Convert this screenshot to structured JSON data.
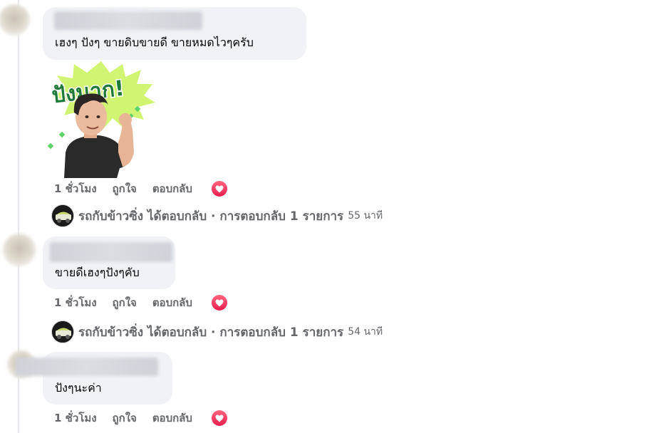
{
  "comments": [
    {
      "text": "เฮงๆ ปังๆ ขายดิบขายดี ขายหมดไวๆครับ",
      "sticker_text": "ปังมาก!",
      "time": "1 ชั่วโมง",
      "like": "ถูกใจ",
      "reply": "ตอบกลับ",
      "reaction": "heart-reaction-icon"
    },
    {
      "text": "ขายดีเฮงๆปังๆคับ",
      "time": "1 ชั่วโมง",
      "like": "ถูกใจ",
      "reply": "ตอบกลับ",
      "reaction": "heart-reaction-icon"
    },
    {
      "text": "ปังๆนะค่า",
      "time": "1 ชั่วโมง",
      "like": "ถูกใจ",
      "reply": "ตอบกลับ",
      "reaction": "heart-reaction-icon"
    }
  ],
  "replies": [
    {
      "text": "รถกับข้าวซิ่ง ได้ตอบกลับ · การตอบกลับ 1 รายการ",
      "time": "55 นาที"
    },
    {
      "text": "รถกับข้าวซิ่ง ได้ตอบกลับ · การตอบกลับ 1 รายการ",
      "time": "54 นาที"
    }
  ],
  "colors": {
    "bubble": "#f0f2f5",
    "meta_text": "#65676b",
    "heart": "#f33e58"
  }
}
